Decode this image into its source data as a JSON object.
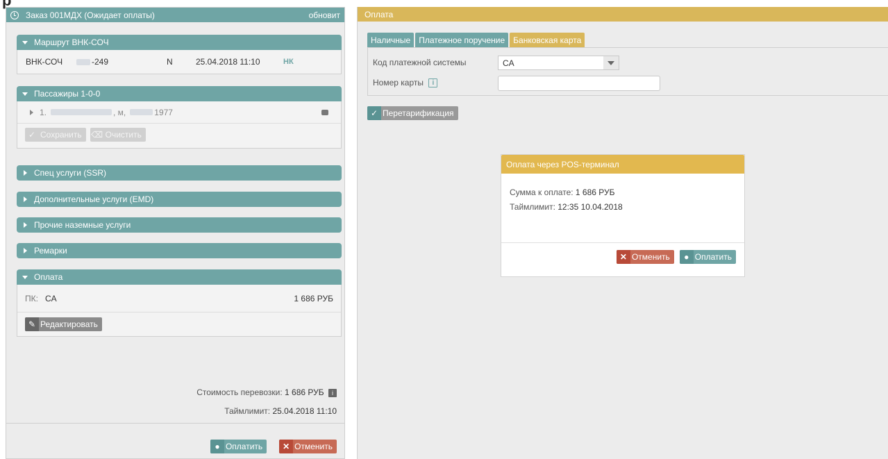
{
  "corner_glyph": "р",
  "order": {
    "title": "Заказ 001МДХ (Ожидает оплаты)",
    "refresh_label": "обновит"
  },
  "route_section": {
    "title": "Маршрут ВНК-СОЧ",
    "route": "ВНК-СОЧ",
    "flight_suffix": "-249",
    "class": "N",
    "datetime": "25.04.2018 11:10",
    "status": "НК"
  },
  "passengers_section": {
    "title": "Пассажиры 1-0-0",
    "passenger_index": "1.",
    "passenger_gender": ", м,",
    "passenger_year": "1977",
    "save_label": "Сохранить",
    "clear_label": "Очистить"
  },
  "collapsed_sections": [
    "Спец услуги (SSR)",
    "Дополнительные услуги (EMD)",
    "Прочие наземные услуги",
    "Ремарки"
  ],
  "payment_section": {
    "title": "Оплата",
    "pk_label": "ПК:",
    "pk_value": "CA",
    "amount": "1 686 РУБ",
    "edit_label": "Редактировать"
  },
  "summary": {
    "cost_label": "Стоимость перевозки:",
    "cost_value": "1 686 РУБ",
    "timelimit_label": "Таймлимит:",
    "timelimit_value": "25.04.2018 11:10"
  },
  "left_footer": {
    "pay_label": "Оплатить",
    "cancel_label": "Отменить"
  },
  "right_panel": {
    "title": "Оплата",
    "tabs": [
      "Наличные",
      "Платежное поручение",
      "Банковская карта"
    ],
    "active_tab": 2,
    "payment_system_label": "Код платежной системы",
    "payment_system_value": "CA",
    "card_number_label": "Номер карты",
    "card_number_value": "",
    "retariff_label": "Перетарификация"
  },
  "pos_modal": {
    "title": "Оплата через POS-терминал",
    "amount_label": "Сумма к оплате:",
    "amount_value": "1 686 РУБ",
    "timelimit_label": "Таймлимит:",
    "timelimit_value": "12:35 10.04.2018",
    "cancel_label": "Отменить",
    "pay_label": "Оплатить"
  },
  "colors": {
    "teal": "#6fa5a5",
    "gold": "#d9b75a",
    "red": "#c76a55"
  }
}
